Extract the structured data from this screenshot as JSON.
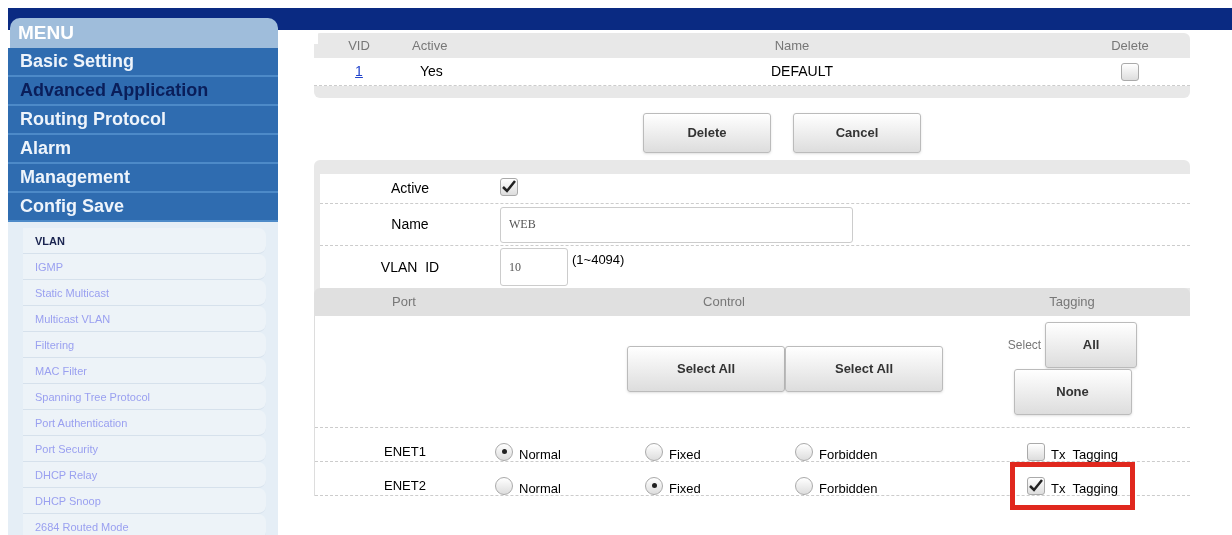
{
  "menu": {
    "title": "MENU",
    "items": [
      {
        "label": "Basic Setting",
        "selected": false
      },
      {
        "label": "Advanced Application",
        "selected": true
      },
      {
        "label": "Routing Protocol",
        "selected": false
      },
      {
        "label": "Alarm",
        "selected": false
      },
      {
        "label": "Management",
        "selected": false
      },
      {
        "label": "Config Save",
        "selected": false
      }
    ]
  },
  "submenu": [
    {
      "label": "VLAN",
      "selected": true
    },
    {
      "label": "IGMP",
      "selected": false
    },
    {
      "label": "Static Multicast",
      "selected": false
    },
    {
      "label": "Multicast VLAN",
      "selected": false
    },
    {
      "label": "Filtering",
      "selected": false
    },
    {
      "label": "MAC Filter",
      "selected": false
    },
    {
      "label": "Spanning Tree Protocol",
      "selected": false
    },
    {
      "label": "Port Authentication",
      "selected": false
    },
    {
      "label": "Port Security",
      "selected": false
    },
    {
      "label": "DHCP Relay",
      "selected": false
    },
    {
      "label": "DHCP Snoop",
      "selected": false
    },
    {
      "label": "2684 Routed Mode",
      "selected": false
    }
  ],
  "vlan_table": {
    "columns": [
      "VID",
      "Active",
      "Name",
      "Delete"
    ],
    "rows": [
      {
        "vid": "1",
        "active": "Yes",
        "name": "DEFAULT",
        "delete_checked": false
      }
    ]
  },
  "table_buttons": [
    "Delete",
    "Cancel"
  ],
  "form": {
    "active_label": "Active",
    "active_checked": true,
    "name_label": "Name",
    "name_value": "WEB",
    "vlan_id_label": "VLAN  ID",
    "vlan_id_value": "10",
    "vlan_id_hint": "(1~4094)"
  },
  "ports": {
    "columns": [
      "Port",
      "Control",
      "Tagging"
    ],
    "select_all_buttons": [
      "Select All",
      "Select All"
    ],
    "select_label": "Select",
    "all_button": "All",
    "none_button": "None",
    "rows": [
      {
        "port": "ENET1",
        "options": [
          {
            "label": "Normal",
            "selected": true
          },
          {
            "label": "Fixed",
            "selected": false
          },
          {
            "label": "Forbidden",
            "selected": false
          }
        ],
        "tx_label": "Tx  Tagging",
        "tx_checked": false,
        "highlighted": false
      },
      {
        "port": "ENET2",
        "options": [
          {
            "label": "Normal",
            "selected": false
          },
          {
            "label": "Fixed",
            "selected": true
          },
          {
            "label": "Forbidden",
            "selected": false
          }
        ],
        "tx_label": "Tx  Tagging",
        "tx_checked": true,
        "highlighted": true
      }
    ]
  }
}
